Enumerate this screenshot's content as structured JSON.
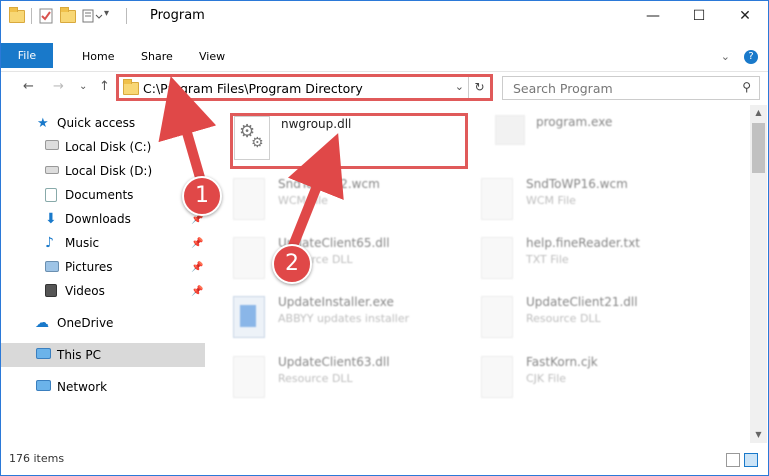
{
  "window": {
    "title": "Program",
    "buttons": {
      "minimize": "—",
      "maximize": "☐",
      "close": "✕"
    }
  },
  "ribbon": {
    "tabs": [
      "File",
      "Home",
      "Share",
      "View"
    ],
    "expand_icon": "⌄",
    "help_icon": "?"
  },
  "addressbar": {
    "path": "C:\\Program Files\\Program Directory",
    "dropdown_icon": "⌄",
    "refresh_icon": "↻",
    "back_icon": "←",
    "forward_icon": "→",
    "recent_icon": "⌄",
    "up_icon": "↑"
  },
  "search": {
    "placeholder": "Search Program",
    "icon": "⚲"
  },
  "nav": {
    "quick_access": "Quick access",
    "items": [
      {
        "label": "Local Disk (C:)",
        "icon": "drive-icon"
      },
      {
        "label": "Local Disk (D:)",
        "icon": "drive-icon"
      },
      {
        "label": "Documents",
        "icon": "documents-icon",
        "pinned": true
      },
      {
        "label": "Downloads",
        "icon": "download-icon",
        "pinned": true
      },
      {
        "label": "Music",
        "icon": "music-icon",
        "pinned": true
      },
      {
        "label": "Pictures",
        "icon": "pictures-icon",
        "pinned": true
      },
      {
        "label": "Videos",
        "icon": "videos-icon",
        "pinned": true
      }
    ],
    "onedrive": "OneDrive",
    "thispc": "This PC",
    "network": "Network"
  },
  "files": [
    {
      "name": "nwgroup.dll",
      "type": "",
      "highlighted": true
    },
    {
      "name": "program.exe",
      "type": ""
    },
    {
      "name": "SndToWP12.wcm",
      "type": "WCM File"
    },
    {
      "name": "SndToWP16.wcm",
      "type": "WCM File"
    },
    {
      "name": "UpdateClient65.dll",
      "type": "Resource DLL"
    },
    {
      "name": "help.fineReader.txt",
      "type": "TXT File"
    },
    {
      "name": "UpdateInstaller.exe",
      "type": "ABBYY updates installer"
    },
    {
      "name": "UpdateClient21.dll",
      "type": "Resource DLL"
    },
    {
      "name": "UpdateClient63.dll",
      "type": "Resource DLL"
    },
    {
      "name": "FastKorn.cjk",
      "type": "CJK File"
    }
  ],
  "status": {
    "count": "176 items"
  },
  "annotations": {
    "step1": "1",
    "step2": "2",
    "color": "#e04848"
  }
}
